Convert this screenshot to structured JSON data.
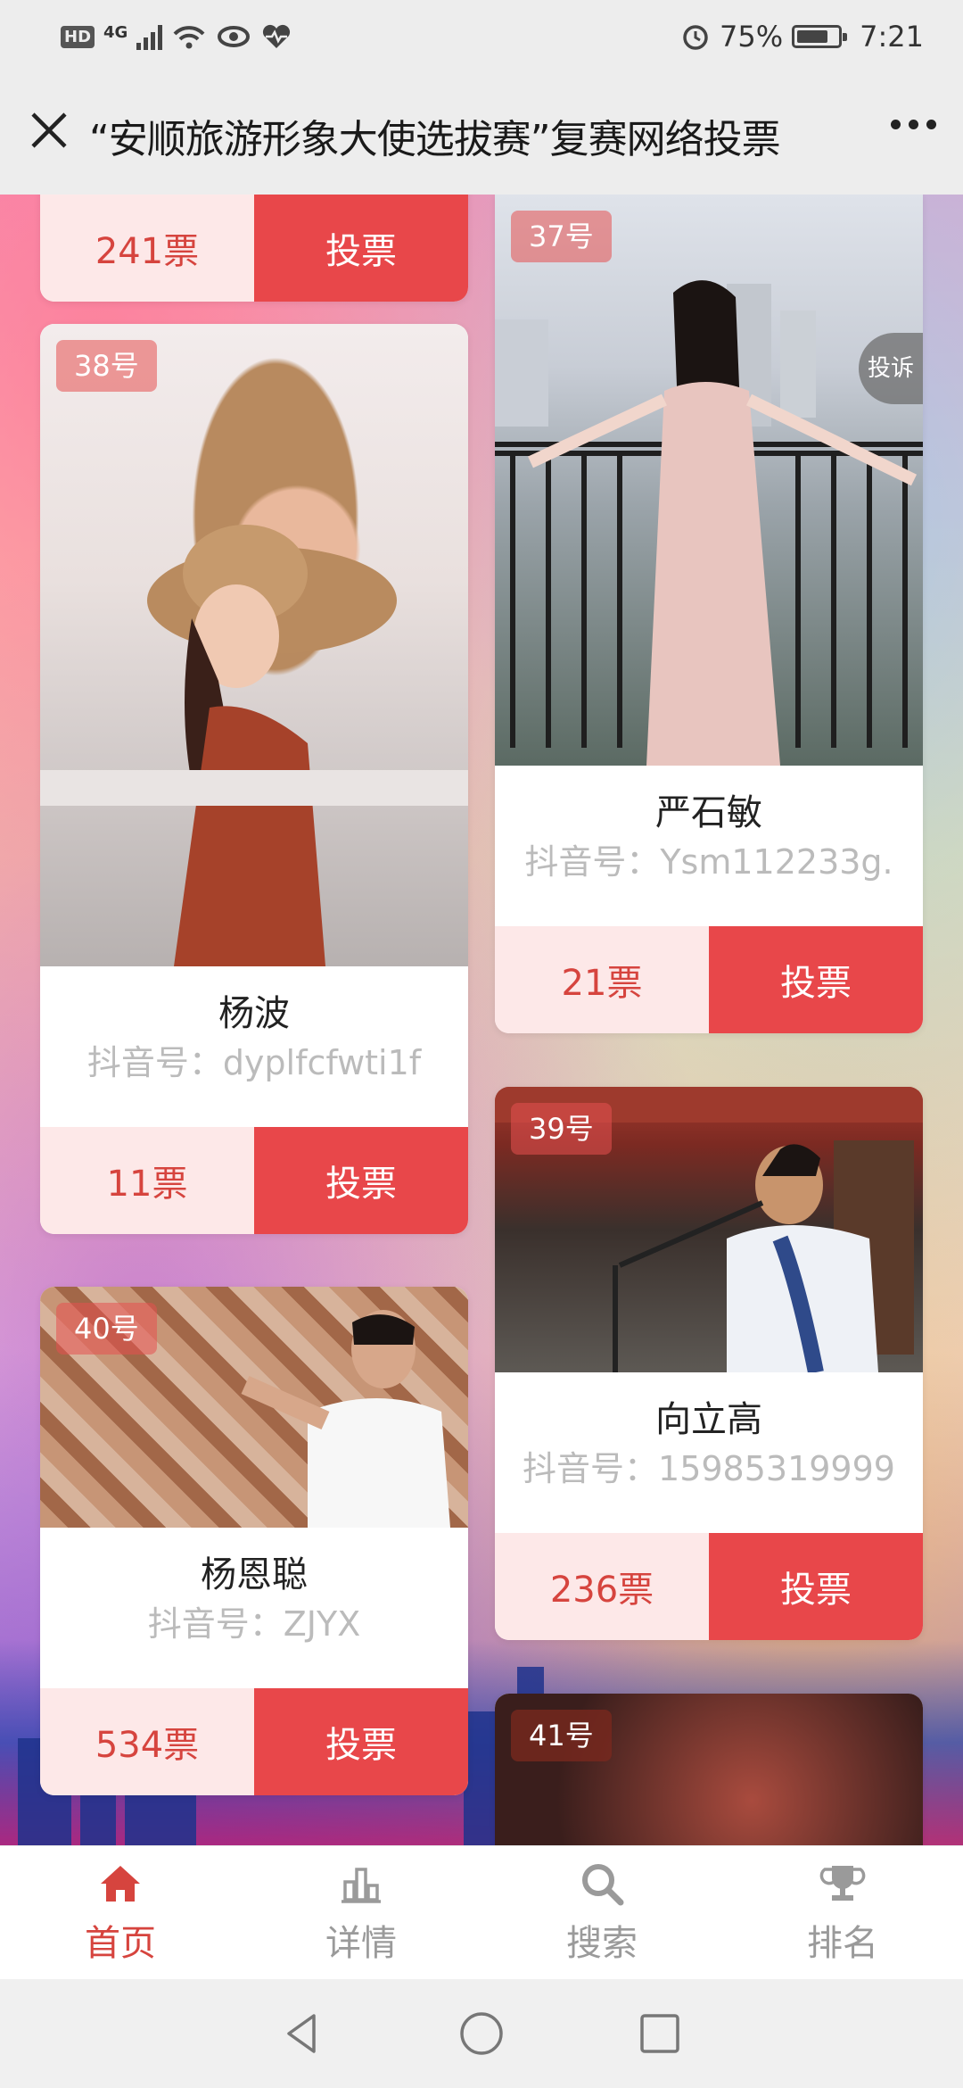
{
  "status_bar": {
    "network": "4G",
    "battery": "75%",
    "time": "7:21"
  },
  "title_bar": {
    "title": "“安顺旅游形象大使选拔赛”复赛网络投票"
  },
  "top_partial_card": {
    "votes": "241票",
    "vote_button": "投票"
  },
  "cards": [
    {
      "number": "38号",
      "name": "杨波",
      "account": "抖音号：dyplfcfwti1f",
      "votes": "11票",
      "vote_button": "投票"
    },
    {
      "number": "37号",
      "name": "严石敏",
      "account": "抖音号：Ysm112233g.",
      "votes": "21票",
      "vote_button": "投票",
      "report": "投诉"
    },
    {
      "number": "39号",
      "name": "向立高",
      "account": "抖音号：15985319999",
      "votes": "236票",
      "vote_button": "投票"
    },
    {
      "number": "40号",
      "name": "杨恩聪",
      "account": "抖音号：ZJYX",
      "votes": "534票",
      "vote_button": "投票"
    },
    {
      "number": "41号"
    }
  ],
  "tab_bar": {
    "tabs": [
      {
        "label": "首页",
        "icon": "home-icon",
        "active": true
      },
      {
        "label": "详情",
        "icon": "chart-icon",
        "active": false
      },
      {
        "label": "搜索",
        "icon": "search-icon",
        "active": false
      },
      {
        "label": "排名",
        "icon": "trophy-icon",
        "active": false
      }
    ]
  },
  "colors": {
    "accent": "#e8474a",
    "vote_bg": "#fde8e8",
    "active_tab": "#d6443e"
  }
}
